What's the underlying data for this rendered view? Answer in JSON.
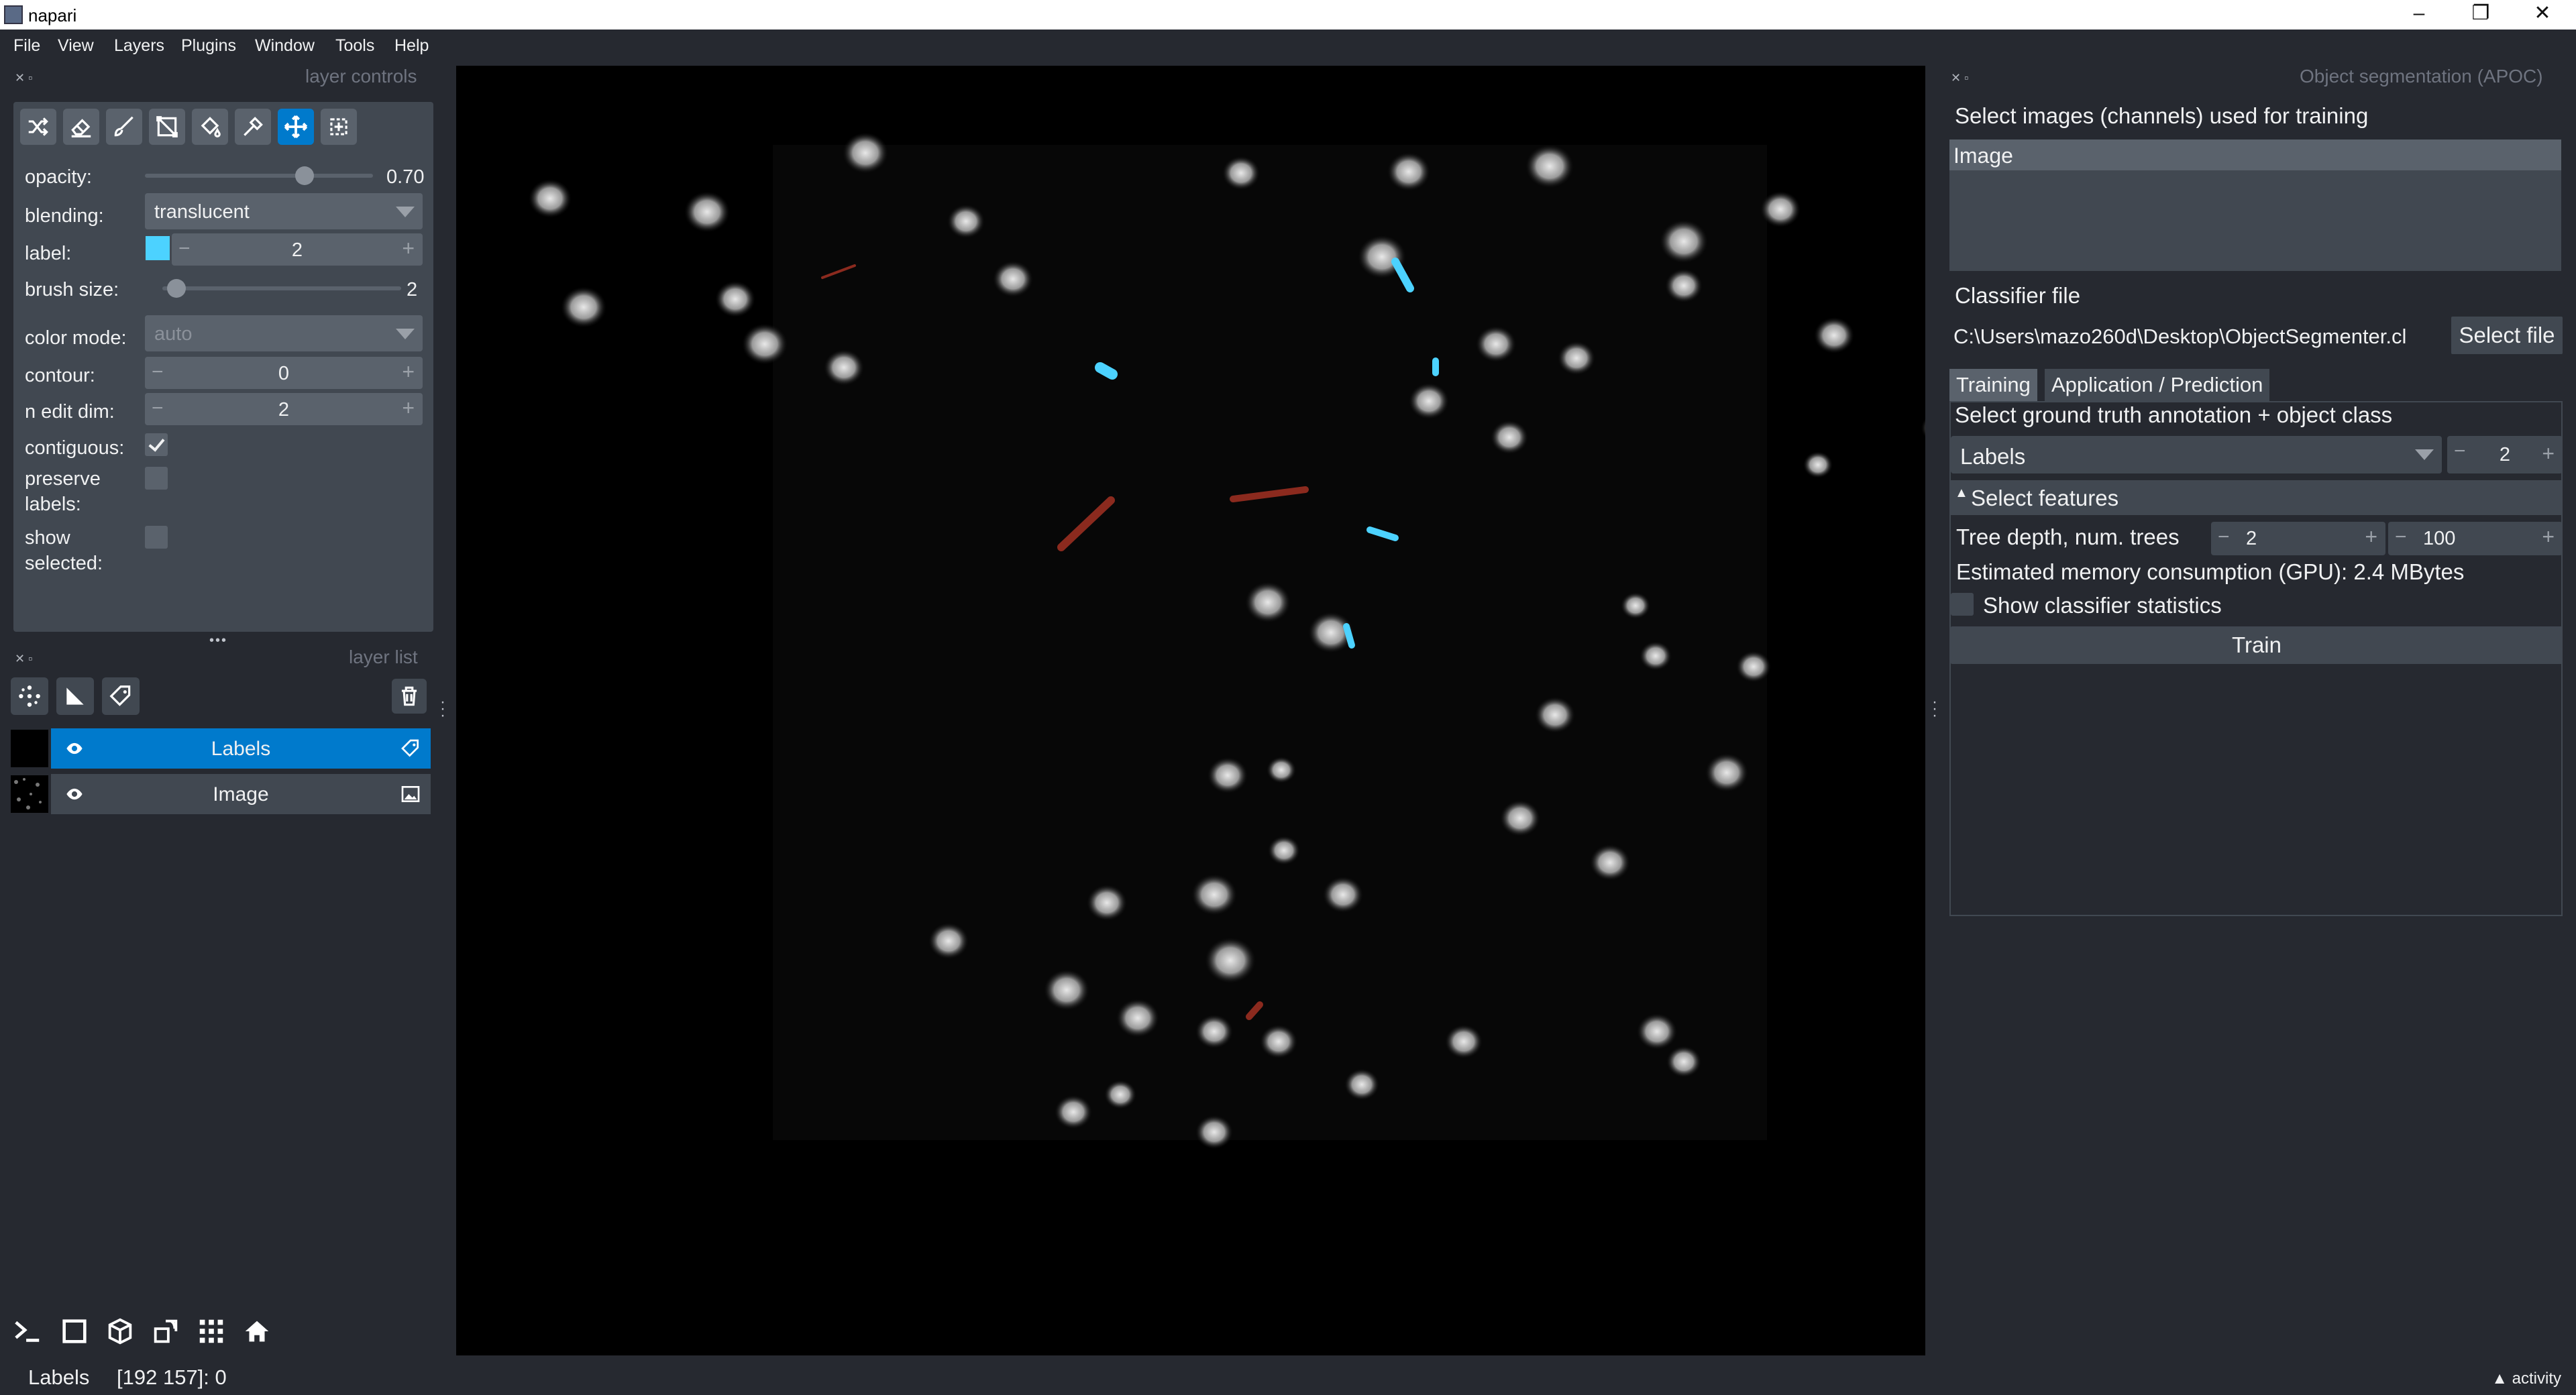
{
  "window": {
    "title": "napari",
    "minimize": "–",
    "maximize": "❐",
    "close": "✕"
  },
  "menubar": [
    "File",
    "View",
    "Layers",
    "Plugins",
    "Window",
    "Tools",
    "Help"
  ],
  "layer_controls": {
    "header": "layer controls",
    "tools": [
      "shuffle-icon",
      "eraser-icon",
      "paintbrush-icon",
      "polygon-icon",
      "fill-bucket-icon",
      "picker-icon",
      "pan-zoom-icon",
      "transform-icon"
    ],
    "active_tool": "pan-zoom-icon",
    "opacity_label": "opacity:",
    "opacity_value": "0.70",
    "opacity_fraction": 0.7,
    "blending_label": "blending:",
    "blending_value": "translucent",
    "label_label": "label:",
    "label_value": "2",
    "label_color": "#4cd2ff",
    "brush_size_label": "brush size:",
    "brush_size_value": "2",
    "brush_fraction": 0.02,
    "color_mode_label": "color mode:",
    "color_mode_value": "auto",
    "contour_label": "contour:",
    "contour_value": "0",
    "n_edit_dim_label": "n edit dim:",
    "n_edit_dim_value": "2",
    "contiguous_label": "contiguous:",
    "contiguous_checked": true,
    "preserve_labels_label_1": "preserve",
    "preserve_labels_label_2": "labels:",
    "preserve_labels_checked": false,
    "show_selected_label_1": "show",
    "show_selected_label_2": "selected:",
    "show_selected_checked": false,
    "more_grip": "•••"
  },
  "layer_list": {
    "header": "layer list",
    "layers": [
      {
        "name": "Labels",
        "selected": true,
        "visible": true,
        "type_icon": "labels-tag-icon"
      },
      {
        "name": "Image",
        "selected": false,
        "visible": true,
        "type_icon": "image-icon"
      }
    ]
  },
  "bottom_toolbar": [
    "console-icon",
    "ndisplay-2d-icon",
    "ndisplay-3d-icon",
    "roll-dims-icon",
    "grid-icon",
    "home-icon"
  ],
  "right_panel": {
    "header": "Object segmentation (APOC)",
    "select_images_label": "Select images (channels) used for training",
    "image_list": [
      "Image"
    ],
    "classifier_file_label": "Classifier file",
    "classifier_file_path": "C:\\Users\\mazo260d\\Desktop\\ObjectSegmenter.cl",
    "select_file_button": "Select file",
    "tabs": [
      "Training",
      "Application / Prediction"
    ],
    "active_tab": "Training",
    "ground_truth_label": "Select ground truth annotation + object class",
    "labels_combo": "Labels",
    "object_class_value": "2",
    "select_features_label": "Select features",
    "tree_label": "Tree depth, num. trees",
    "tree_depth_value": "2",
    "num_trees_value": "100",
    "memory_label": "Estimated memory consumption (GPU): 2.4 MBytes",
    "show_stats_label": "Show classifier statistics",
    "train_button": "Train"
  },
  "statusbar": {
    "layer": "Labels",
    "coords": "[192 157]: 0",
    "activity": "▲ activity"
  },
  "colors": {
    "background": "#262930",
    "panel": "#414851",
    "accent": "#007acc",
    "label_blue": "#4cd2ff",
    "label_red": "#8b2a1e"
  }
}
